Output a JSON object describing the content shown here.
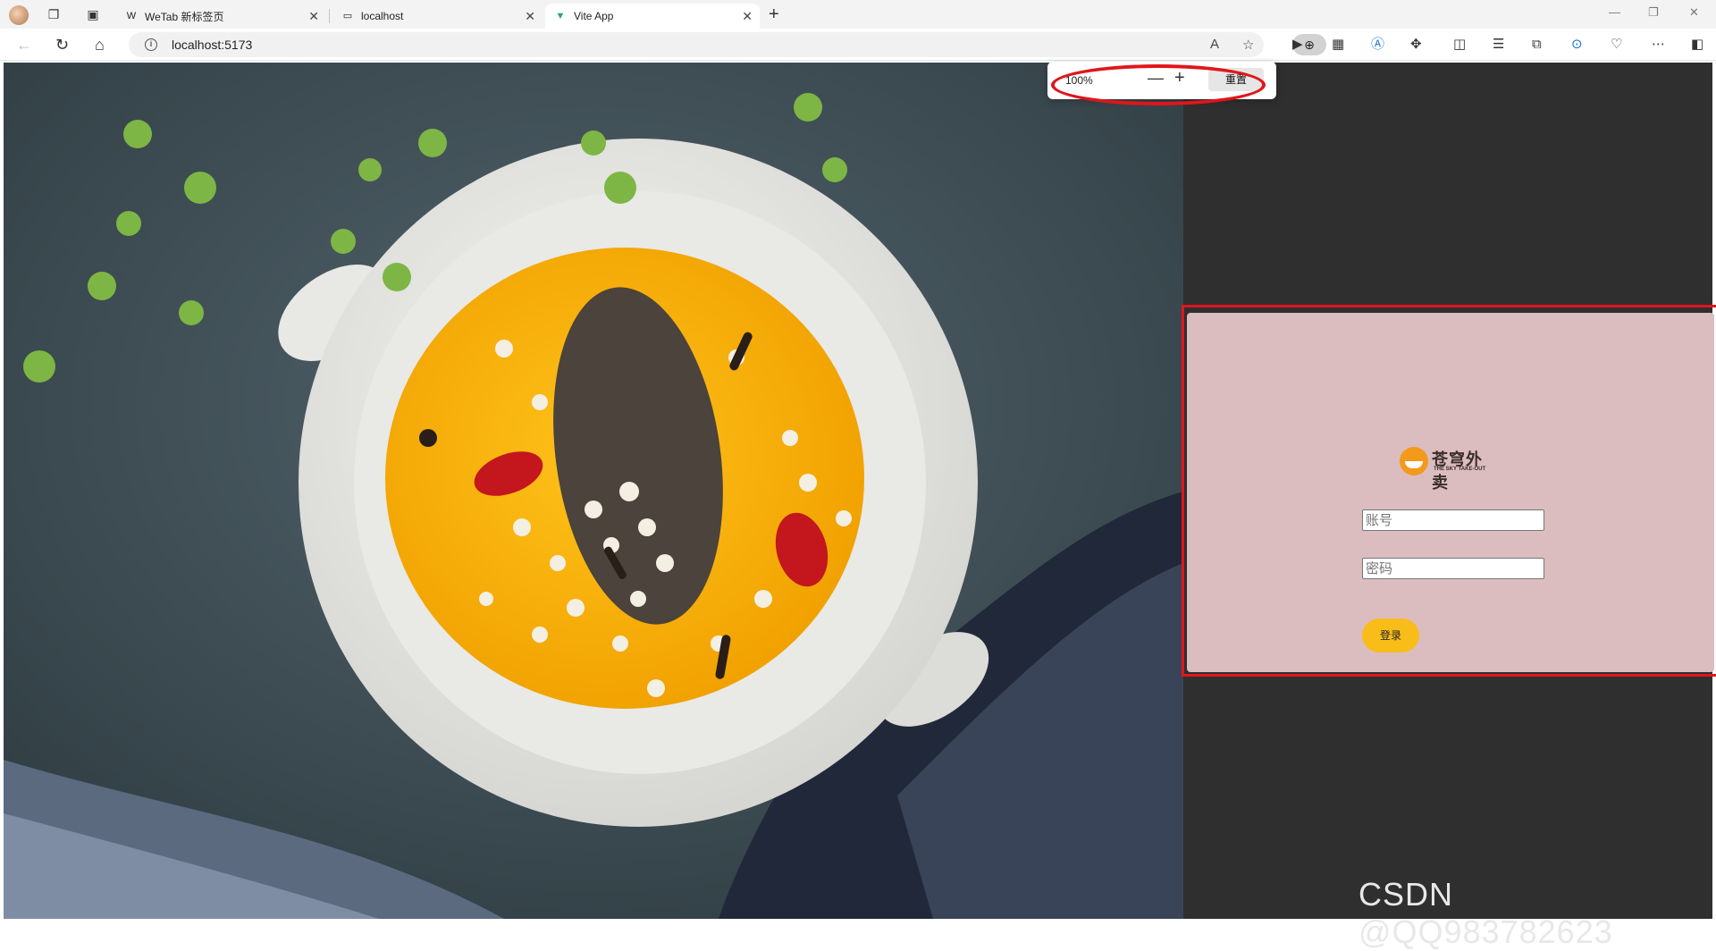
{
  "browser": {
    "tabs": [
      {
        "title": "WeTab 新标签页",
        "active": false,
        "favicon": "wetab-icon"
      },
      {
        "title": "localhost",
        "active": false,
        "favicon": "page-icon"
      },
      {
        "title": "Vite App",
        "active": true,
        "favicon": "vite-icon"
      }
    ],
    "address": {
      "url": "localhost:5173"
    },
    "zoom_popup": {
      "percent": "100%",
      "reset_label": "重置"
    }
  },
  "page": {
    "logo": {
      "cn": "苍穹外卖",
      "en": "THE SKY TAKE-OUT"
    },
    "account_placeholder": "账号",
    "password_placeholder": "密码",
    "login_label": "登录"
  },
  "watermark": "CSDN @QQ983782623",
  "colors": {
    "login_bg": "#dbbdbf",
    "login_button": "#f8bd18",
    "highlight": "#e0161b",
    "page_bg": "#2f2f2f"
  }
}
